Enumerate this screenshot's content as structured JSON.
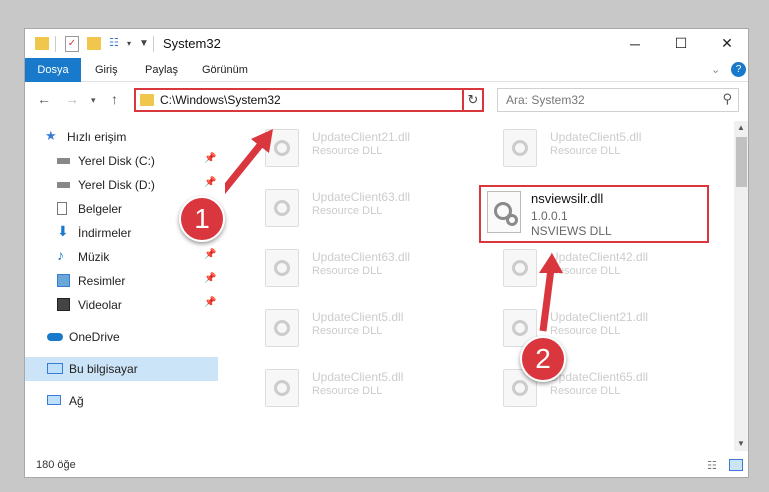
{
  "window": {
    "title": "System32"
  },
  "ribbon": {
    "tabs": [
      "Dosya",
      "Giriş",
      "Paylaş",
      "Görünüm"
    ]
  },
  "nav": {
    "address": "C:\\Windows\\System32",
    "search_placeholder": "Ara: System32"
  },
  "sidebar": {
    "items": [
      {
        "label": "Hızlı erişim",
        "icon": "star-icon"
      },
      {
        "label": "Yerel Disk (C:)",
        "icon": "drive-icon"
      },
      {
        "label": "Yerel Disk (D:)",
        "icon": "drive-icon"
      },
      {
        "label": "Belgeler",
        "icon": "document-icon"
      },
      {
        "label": "İndirmeler",
        "icon": "download-icon"
      },
      {
        "label": "Müzik",
        "icon": "music-icon"
      },
      {
        "label": "Resimler",
        "icon": "pictures-icon"
      },
      {
        "label": "Videolar",
        "icon": "video-icon"
      },
      {
        "label": "OneDrive",
        "icon": "cloud-icon"
      },
      {
        "label": "Bu bilgisayar",
        "icon": "computer-icon"
      },
      {
        "label": "Ağ",
        "icon": "network-icon"
      }
    ]
  },
  "files": [
    {
      "name": "UpdateClient21.dll",
      "desc": "Resource DLL"
    },
    {
      "name": "UpdateClient5.dll",
      "desc": "Resource DLL"
    },
    {
      "name": "UpdateClient63.dll",
      "desc": "Resource DLL"
    },
    {
      "name": "UpdateClient63.dll",
      "desc": "Resource DLL"
    },
    {
      "name": "UpdateClient42.dll",
      "desc": "Resource DLL"
    },
    {
      "name": "UpdateClient5.dll",
      "desc": "Resource DLL"
    },
    {
      "name": "UpdateClient21.dll",
      "desc": "Resource DLL"
    },
    {
      "name": "UpdateClient5.dll",
      "desc": "Resource DLL"
    },
    {
      "name": "UpdateClient65.dll",
      "desc": "Resource DLL"
    }
  ],
  "selected_file": {
    "name": "nsviewsilr.dll",
    "version": "1.0.0.1",
    "desc": "NSVIEWS DLL"
  },
  "status": {
    "count": "180 öğe"
  },
  "annotations": [
    "1",
    "2"
  ],
  "colors": {
    "accent": "#1979ca",
    "highlight": "#d9363e"
  }
}
